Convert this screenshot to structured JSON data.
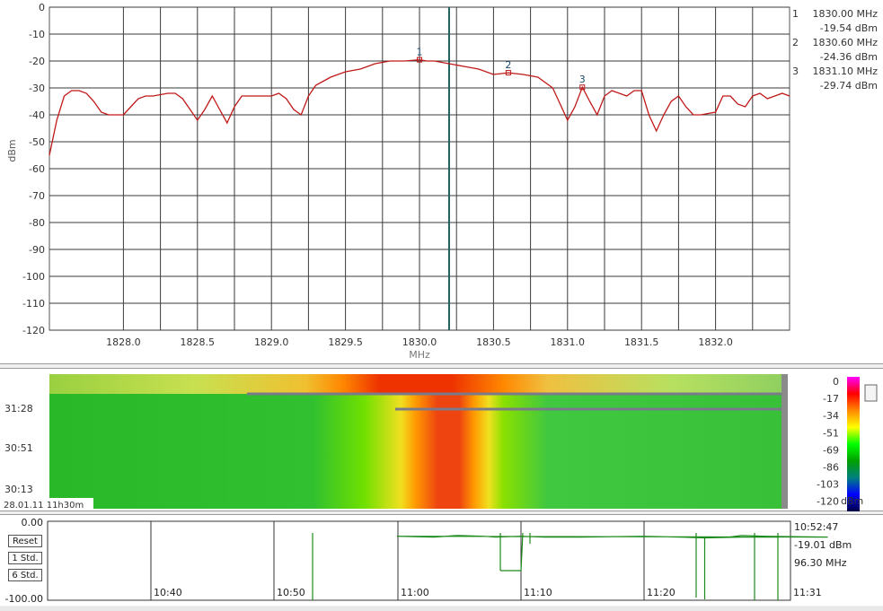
{
  "chart_data": [
    {
      "type": "line",
      "ylabel": "dBm",
      "xlabel": "MHz",
      "ylim": [
        -120,
        0
      ],
      "xlim": [
        1827.5,
        1832.5
      ],
      "yticks": [
        "0",
        "-10",
        "-20",
        "-30",
        "-40",
        "-50",
        "-60",
        "-70",
        "-80",
        "-90",
        "-100",
        "-110",
        "-120"
      ],
      "xticks": [
        "1828.0",
        "1828.5",
        "1829.0",
        "1829.5",
        "1830.0",
        "1830.5",
        "1831.0",
        "1831.5",
        "1832.0"
      ],
      "grid": true,
      "cursor_x": 1830.2,
      "series": [
        {
          "color": "#c01818",
          "x": [
            1827.5,
            1827.55,
            1827.6,
            1827.65,
            1827.7,
            1827.75,
            1827.8,
            1827.85,
            1827.9,
            1827.95,
            1828.0,
            1828.05,
            1828.1,
            1828.15,
            1828.2,
            1828.3,
            1828.35,
            1828.4,
            1828.45,
            1828.5,
            1828.55,
            1828.6,
            1828.65,
            1828.7,
            1828.75,
            1828.8,
            1828.85,
            1828.9,
            1828.95,
            1829.0,
            1829.05,
            1829.1,
            1829.15,
            1829.2,
            1829.25,
            1829.3,
            1829.4,
            1829.5,
            1829.6,
            1829.7,
            1829.8,
            1829.9,
            1830.0,
            1830.05,
            1830.1,
            1830.2,
            1830.3,
            1830.4,
            1830.5,
            1830.6,
            1830.7,
            1830.8,
            1830.9,
            1830.95,
            1831.0,
            1831.05,
            1831.1,
            1831.15,
            1831.2,
            1831.25,
            1831.3,
            1831.35,
            1831.4,
            1831.45,
            1831.5,
            1831.55,
            1831.6,
            1831.65,
            1831.7,
            1831.75,
            1831.8,
            1831.85,
            1831.9,
            1832.0,
            1832.05,
            1832.1,
            1832.15,
            1832.2,
            1832.25,
            1832.3,
            1832.35,
            1832.4,
            1832.45,
            1832.5
          ],
          "y": [
            -55,
            -42,
            -33,
            -31,
            -31,
            -32,
            -35,
            -39,
            -40,
            -40,
            -40,
            -37,
            -34,
            -33,
            -33,
            -32,
            -32,
            -34,
            -38,
            -42,
            -38,
            -33,
            -38,
            -43,
            -37,
            -33,
            -33,
            -33,
            -33,
            -33,
            -32,
            -34,
            -38,
            -40,
            -33,
            -29,
            -26,
            -24,
            -23,
            -21,
            -20,
            -20,
            -19.54,
            -20,
            -20,
            -21,
            -22,
            -23,
            -25,
            -24.36,
            -25,
            -26,
            -30,
            -36,
            -42,
            -37,
            -29.74,
            -35,
            -40,
            -33,
            -31,
            -32,
            -33,
            -31,
            -31,
            -40,
            -46,
            -40,
            -35,
            -33,
            -37,
            -40,
            -40,
            -39,
            -33,
            -33,
            -36,
            -37,
            -33,
            -32,
            -34,
            -33,
            -32,
            -33
          ]
        }
      ],
      "markers": [
        {
          "num": "1",
          "freq": "1830.00 MHz",
          "level": "-19.54 dBm",
          "x": 1830.0,
          "y": -19.54
        },
        {
          "num": "2",
          "freq": "1830.60 MHz",
          "level": "-24.36 dBm",
          "x": 1830.6,
          "y": -24.36
        },
        {
          "num": "3",
          "freq": "1831.10 MHz",
          "level": "-29.74 dBm",
          "x": 1831.1,
          "y": -29.74
        }
      ]
    },
    {
      "type": "heatmap",
      "time_labels": [
        "31:28",
        "30:51",
        "30:13"
      ],
      "timestamp": "28.01.11 11h30m",
      "scale_labels": [
        "0",
        "-17",
        "-34",
        "-51",
        "-69",
        "-86",
        "-103",
        "-120"
      ],
      "scale_unit": "dBm",
      "scale_colors": [
        "#ff00ff",
        "#ff0000",
        "#ff8800",
        "#ffff00",
        "#00ff00",
        "#00a000",
        "#008080",
        "#0000ff",
        "#000040"
      ]
    },
    {
      "type": "line",
      "ylim": [
        -100,
        0
      ],
      "ytick_labels": [
        "0.00",
        "-100.00"
      ],
      "xtick_labels": [
        "10:40",
        "10:50",
        "11:00",
        "11:10",
        "11:20",
        "11:31"
      ],
      "buttons": [
        "Reset",
        "1 Std.",
        "6 Std."
      ],
      "readout": {
        "time": "10:52:47",
        "level": "-19.01 dBm",
        "freq": "96.30 MHz"
      },
      "series": [
        {
          "color": "#1a8a1a",
          "x": [
            10.85,
            10.87,
            10.88,
            10.9,
            10.95,
            11.0,
            11.03,
            11.05,
            11.07,
            11.08,
            11.1,
            11.12,
            11.13,
            11.15,
            11.2,
            11.23,
            11.25,
            11.28,
            11.3,
            11.31
          ],
          "y": [
            -20,
            -20,
            -18,
            -19,
            -20,
            -19,
            -20,
            -18,
            -19,
            -20,
            -19,
            -20,
            -20,
            -20,
            -19,
            -20,
            -21,
            -20,
            -20,
            -20
          ]
        }
      ]
    }
  ]
}
